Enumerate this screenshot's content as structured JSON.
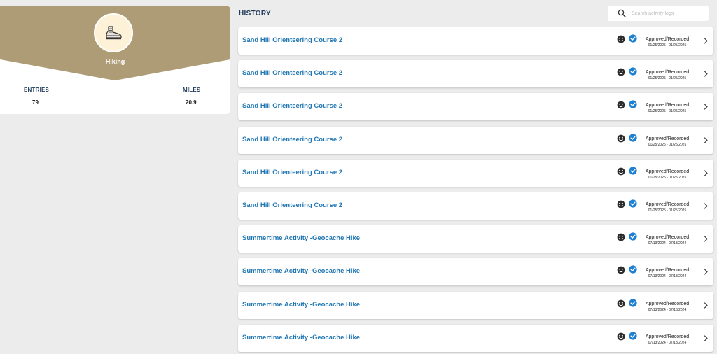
{
  "summary": {
    "activity_name": "Hiking",
    "activity_icon": "hiking-boot-icon",
    "entries_label": "ENTRIES",
    "entries_value": "79",
    "miles_label": "MILES",
    "miles_value": "20.9",
    "banner_color": "#ad9c75"
  },
  "history": {
    "title": "HISTORY",
    "search_placeholder": "Search activity logs",
    "link_color": "#2177b4",
    "check_color": "#1f7fd1",
    "rows": [
      {
        "title": "Sand Hill Orienteering Course 2",
        "status": "Approved/Recorded",
        "dates": "01/25/2025 - 01/25/2025"
      },
      {
        "title": "Sand Hill Orienteering Course 2",
        "status": "Approved/Recorded",
        "dates": "01/25/2025 - 01/25/2025"
      },
      {
        "title": "Sand Hill Orienteering Course 2",
        "status": "Approved/Recorded",
        "dates": "01/25/2025 - 01/25/2025"
      },
      {
        "title": "Sand Hill Orienteering Course 2",
        "status": "Approved/Recorded",
        "dates": "01/25/2025 - 01/25/2025"
      },
      {
        "title": "Sand Hill Orienteering Course 2",
        "status": "Approved/Recorded",
        "dates": "01/25/2025 - 01/25/2025"
      },
      {
        "title": "Sand Hill Orienteering Course 2",
        "status": "Approved/Recorded",
        "dates": "01/25/2025 - 01/25/2025"
      },
      {
        "title": "Summertime Activity -Geocache Hike",
        "status": "Approved/Recorded",
        "dates": "07/13/2024 - 07/13/2024"
      },
      {
        "title": "Summertime Activity -Geocache Hike",
        "status": "Approved/Recorded",
        "dates": "07/13/2024 - 07/13/2024"
      },
      {
        "title": "Summertime Activity -Geocache Hike",
        "status": "Approved/Recorded",
        "dates": "07/13/2024 - 07/13/2024"
      },
      {
        "title": "Summertime Activity -Geocache Hike",
        "status": "Approved/Recorded",
        "dates": "07/13/2024 - 07/13/2024"
      }
    ]
  }
}
